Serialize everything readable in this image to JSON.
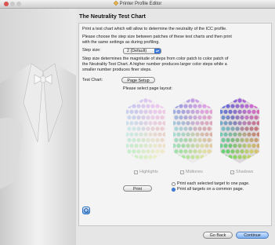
{
  "window": {
    "title": "Printer Profile Editor"
  },
  "header": {
    "title": "The Neutrality Test Chart"
  },
  "intro": {
    "line1": "Print a test chart which will allow to determine the neutrality of the ICC profile.",
    "line2a": "Please choose the step size between patches of these test charts and then print",
    "line2b": "with the same settings as during profiling."
  },
  "step": {
    "label": "Step size:",
    "selected": "2 (Default)",
    "desc1": "Step size determines the magnitude of steps from color patch to color patch of",
    "desc2": "the Neutrality Test Chart. A higher number produces larger color steps while a",
    "desc3": "smaller number produces finer steps."
  },
  "testchart": {
    "label": "Test Chart:",
    "page_setup": "Page Setup",
    "layout_label": "Please select page layout:"
  },
  "targets": [
    {
      "label": "Highlights",
      "checked": true
    },
    {
      "label": "Midtones",
      "checked": true
    },
    {
      "label": "Shadows",
      "checked": true
    }
  ],
  "print": {
    "button": "Print",
    "option1": "Print each selected target to one page.",
    "option2": "Print all targets on a common page."
  },
  "nav": {
    "back": "Go Back",
    "continue": "Continue"
  },
  "colors": {
    "accent": "#3c79d8",
    "close": "#d9534f"
  },
  "icons": {
    "help": "help-icon",
    "app": "printer-profile-icon"
  }
}
